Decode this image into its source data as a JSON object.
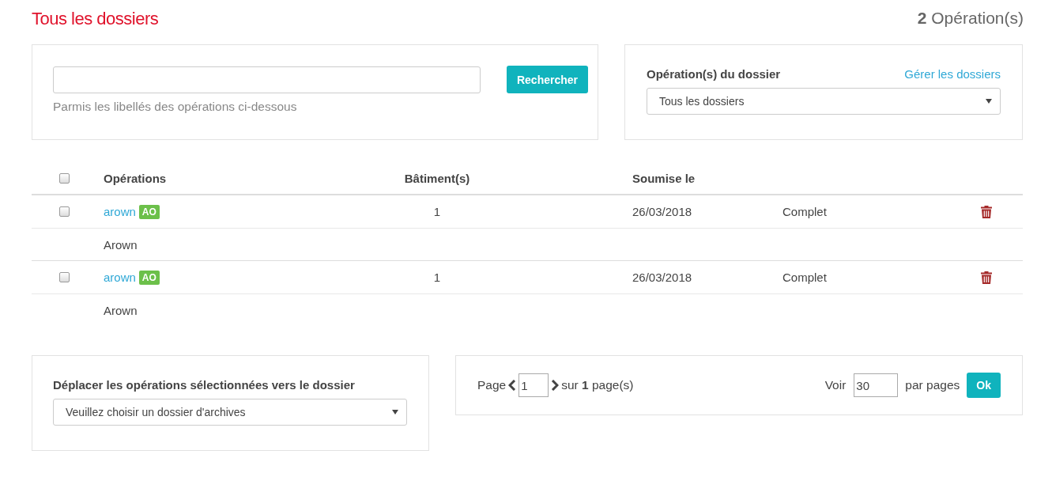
{
  "page_title": "Tous les dossiers",
  "operation_count": "**2** Opération(s)",
  "search": {
    "button": "Rechercher",
    "hint": "Parmis les libellés des opérations ci-dessous"
  },
  "folder_filter": {
    "label": "Opération(s) du dossier",
    "link": "Gérer les dossiers",
    "value": "Tous les dossiers"
  },
  "table": {
    "select_all_checked": false,
    "columns": [
      "Opérations",
      "Bâtiment(s)",
      "Soumise le"
    ],
    "rows": [
      {
        "checked": false,
        "name": "arown",
        "tag": "AO",
        "buildings": "1",
        "submitted": "26/03/2018",
        "status": "Complet",
        "description": "Arown"
      },
      {
        "checked": false,
        "name": "arown",
        "tag": "AO",
        "buildings": "1",
        "submitted": "26/03/2018",
        "status": "Complet",
        "description": "Arown"
      }
    ]
  },
  "move": {
    "label": "Déplacer les opérations sélectionnées vers le dossier",
    "value": "Veuillez choisir un dossier d'archives"
  },
  "pagination": {
    "page_label": "Page",
    "page": "1",
    "total": "sur **1** page(s)",
    "show_label": "Voir",
    "per_page": "30",
    "per_page_label": "par pages",
    "button": "Ok"
  }
}
